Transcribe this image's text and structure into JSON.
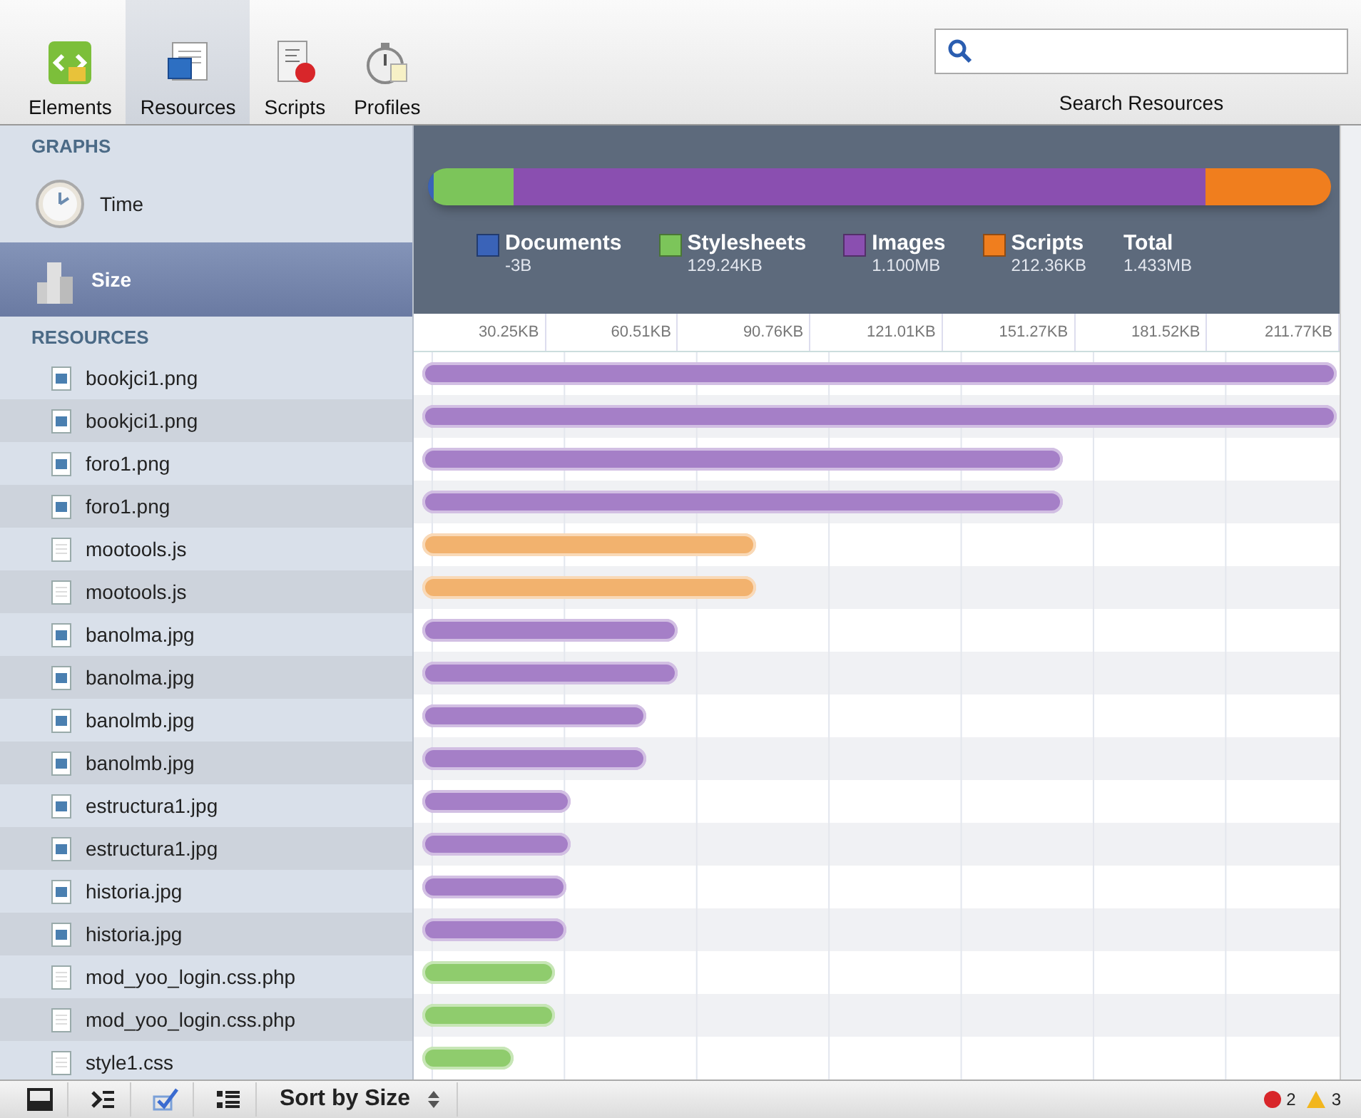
{
  "toolbar": {
    "tabs": [
      {
        "label": "Elements",
        "kind": "elements",
        "selected": false
      },
      {
        "label": "Resources",
        "kind": "resources",
        "selected": true
      },
      {
        "label": "Scripts",
        "kind": "scripts",
        "selected": false
      },
      {
        "label": "Profiles",
        "kind": "profiles",
        "selected": false
      }
    ],
    "search": {
      "label": "Search Resources"
    }
  },
  "sidebar": {
    "graphs_heading": "GRAPHS",
    "graphs": [
      {
        "label": "Time",
        "kind": "time",
        "selected": false
      },
      {
        "label": "Size",
        "kind": "size",
        "selected": true
      }
    ],
    "resources_heading": "RESOURCES",
    "resources": [
      {
        "name": "bookjci1.png",
        "kind": "image",
        "level": 1.0
      },
      {
        "name": "bookjci1.png",
        "kind": "image",
        "level": 1.0
      },
      {
        "name": "foro1.png",
        "kind": "image",
        "level": 0.7
      },
      {
        "name": "foro1.png",
        "kind": "image",
        "level": 0.7
      },
      {
        "name": "mootools.js",
        "kind": "script",
        "level": 0.365
      },
      {
        "name": "mootools.js",
        "kind": "script",
        "level": 0.365
      },
      {
        "name": "banolma.jpg",
        "kind": "image",
        "level": 0.28
      },
      {
        "name": "banolma.jpg",
        "kind": "image",
        "level": 0.28
      },
      {
        "name": "banolmb.jpg",
        "kind": "image",
        "level": 0.245
      },
      {
        "name": "banolmb.jpg",
        "kind": "image",
        "level": 0.245
      },
      {
        "name": "estructura1.jpg",
        "kind": "image",
        "level": 0.163
      },
      {
        "name": "estructura1.jpg",
        "kind": "image",
        "level": 0.163
      },
      {
        "name": "historia.jpg",
        "kind": "image",
        "level": 0.158
      },
      {
        "name": "historia.jpg",
        "kind": "image",
        "level": 0.158
      },
      {
        "name": "mod_yoo_login.css.php",
        "kind": "stylesheet",
        "level": 0.145
      },
      {
        "name": "mod_yoo_login.css.php",
        "kind": "stylesheet",
        "level": 0.145
      },
      {
        "name": "style1.css",
        "kind": "stylesheet",
        "level": 0.1
      }
    ]
  },
  "summary": {
    "categories": [
      {
        "label": "Documents",
        "value": "-3B",
        "color": "#3a63b8"
      },
      {
        "label": "Stylesheets",
        "value": "129.24KB",
        "color": "#7cc55a"
      },
      {
        "label": "Images",
        "value": "1.100MB",
        "color": "#8a4fb0"
      },
      {
        "label": "Scripts",
        "value": "212.36KB",
        "color": "#f07e1e"
      }
    ],
    "total": {
      "label": "Total",
      "value": "1.433MB"
    }
  },
  "scale": [
    "30.25KB",
    "60.51KB",
    "90.76KB",
    "121.01KB",
    "151.27KB",
    "181.52KB",
    "211.77KB"
  ],
  "status_bar": {
    "sort": "Sort by Size",
    "errors": "2",
    "warnings": "3"
  }
}
